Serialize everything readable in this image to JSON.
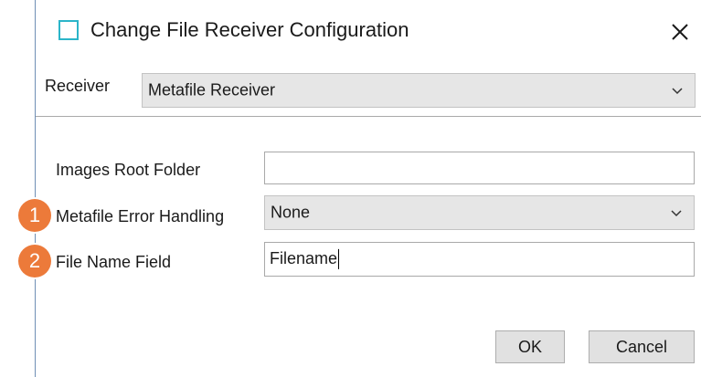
{
  "dialog": {
    "title": "Change File Receiver Configuration",
    "icon": "window-icon",
    "close_icon": "close-icon"
  },
  "receiver": {
    "label": "Receiver",
    "selected": "Metafile Receiver"
  },
  "fields": {
    "images_root_folder": {
      "label": "Images Root Folder",
      "value": ""
    },
    "metafile_error_handling": {
      "label": "Metafile Error Handling",
      "selected": "None",
      "badge": "1"
    },
    "file_name_field": {
      "label": "File Name Field",
      "value": "Filename",
      "badge": "2"
    }
  },
  "buttons": {
    "ok": "OK",
    "cancel": "Cancel"
  },
  "colors": {
    "badge": "#ec7a3a",
    "icon_accent": "#2bb5c9",
    "combo_bg": "#e6e6e6",
    "button_bg": "#e1e1e1"
  }
}
